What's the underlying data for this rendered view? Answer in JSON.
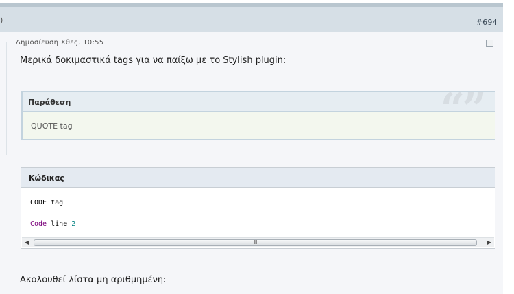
{
  "header": {
    "left_mark": ")",
    "post_number": "#694"
  },
  "post": {
    "date": "Δημοσίευση Χθες, 10:55",
    "intro": "Μερικά δοκιμαστικά tags για να παίξω με το Stylish plugin:",
    "quote": {
      "title": "Παράθεση",
      "content": "QUOTE tag"
    },
    "code": {
      "title": "Κώδικας",
      "line1": "CODE tag",
      "line2_keyword": "Code",
      "line2_text": "line",
      "line2_number": "2"
    },
    "outro": "Ακολουθεί λίστα μη αριθμημένη:"
  },
  "scrollbar": {
    "left_arrow": "◀",
    "right_arrow": "▶",
    "grip": "III"
  },
  "decor": {
    "quote_marks": "“”"
  },
  "colors": {
    "header_bg": "#d6dfe6",
    "quote_bg": "#f3f7ee",
    "code_keyword": "#7a007a",
    "code_number": "#008080"
  }
}
